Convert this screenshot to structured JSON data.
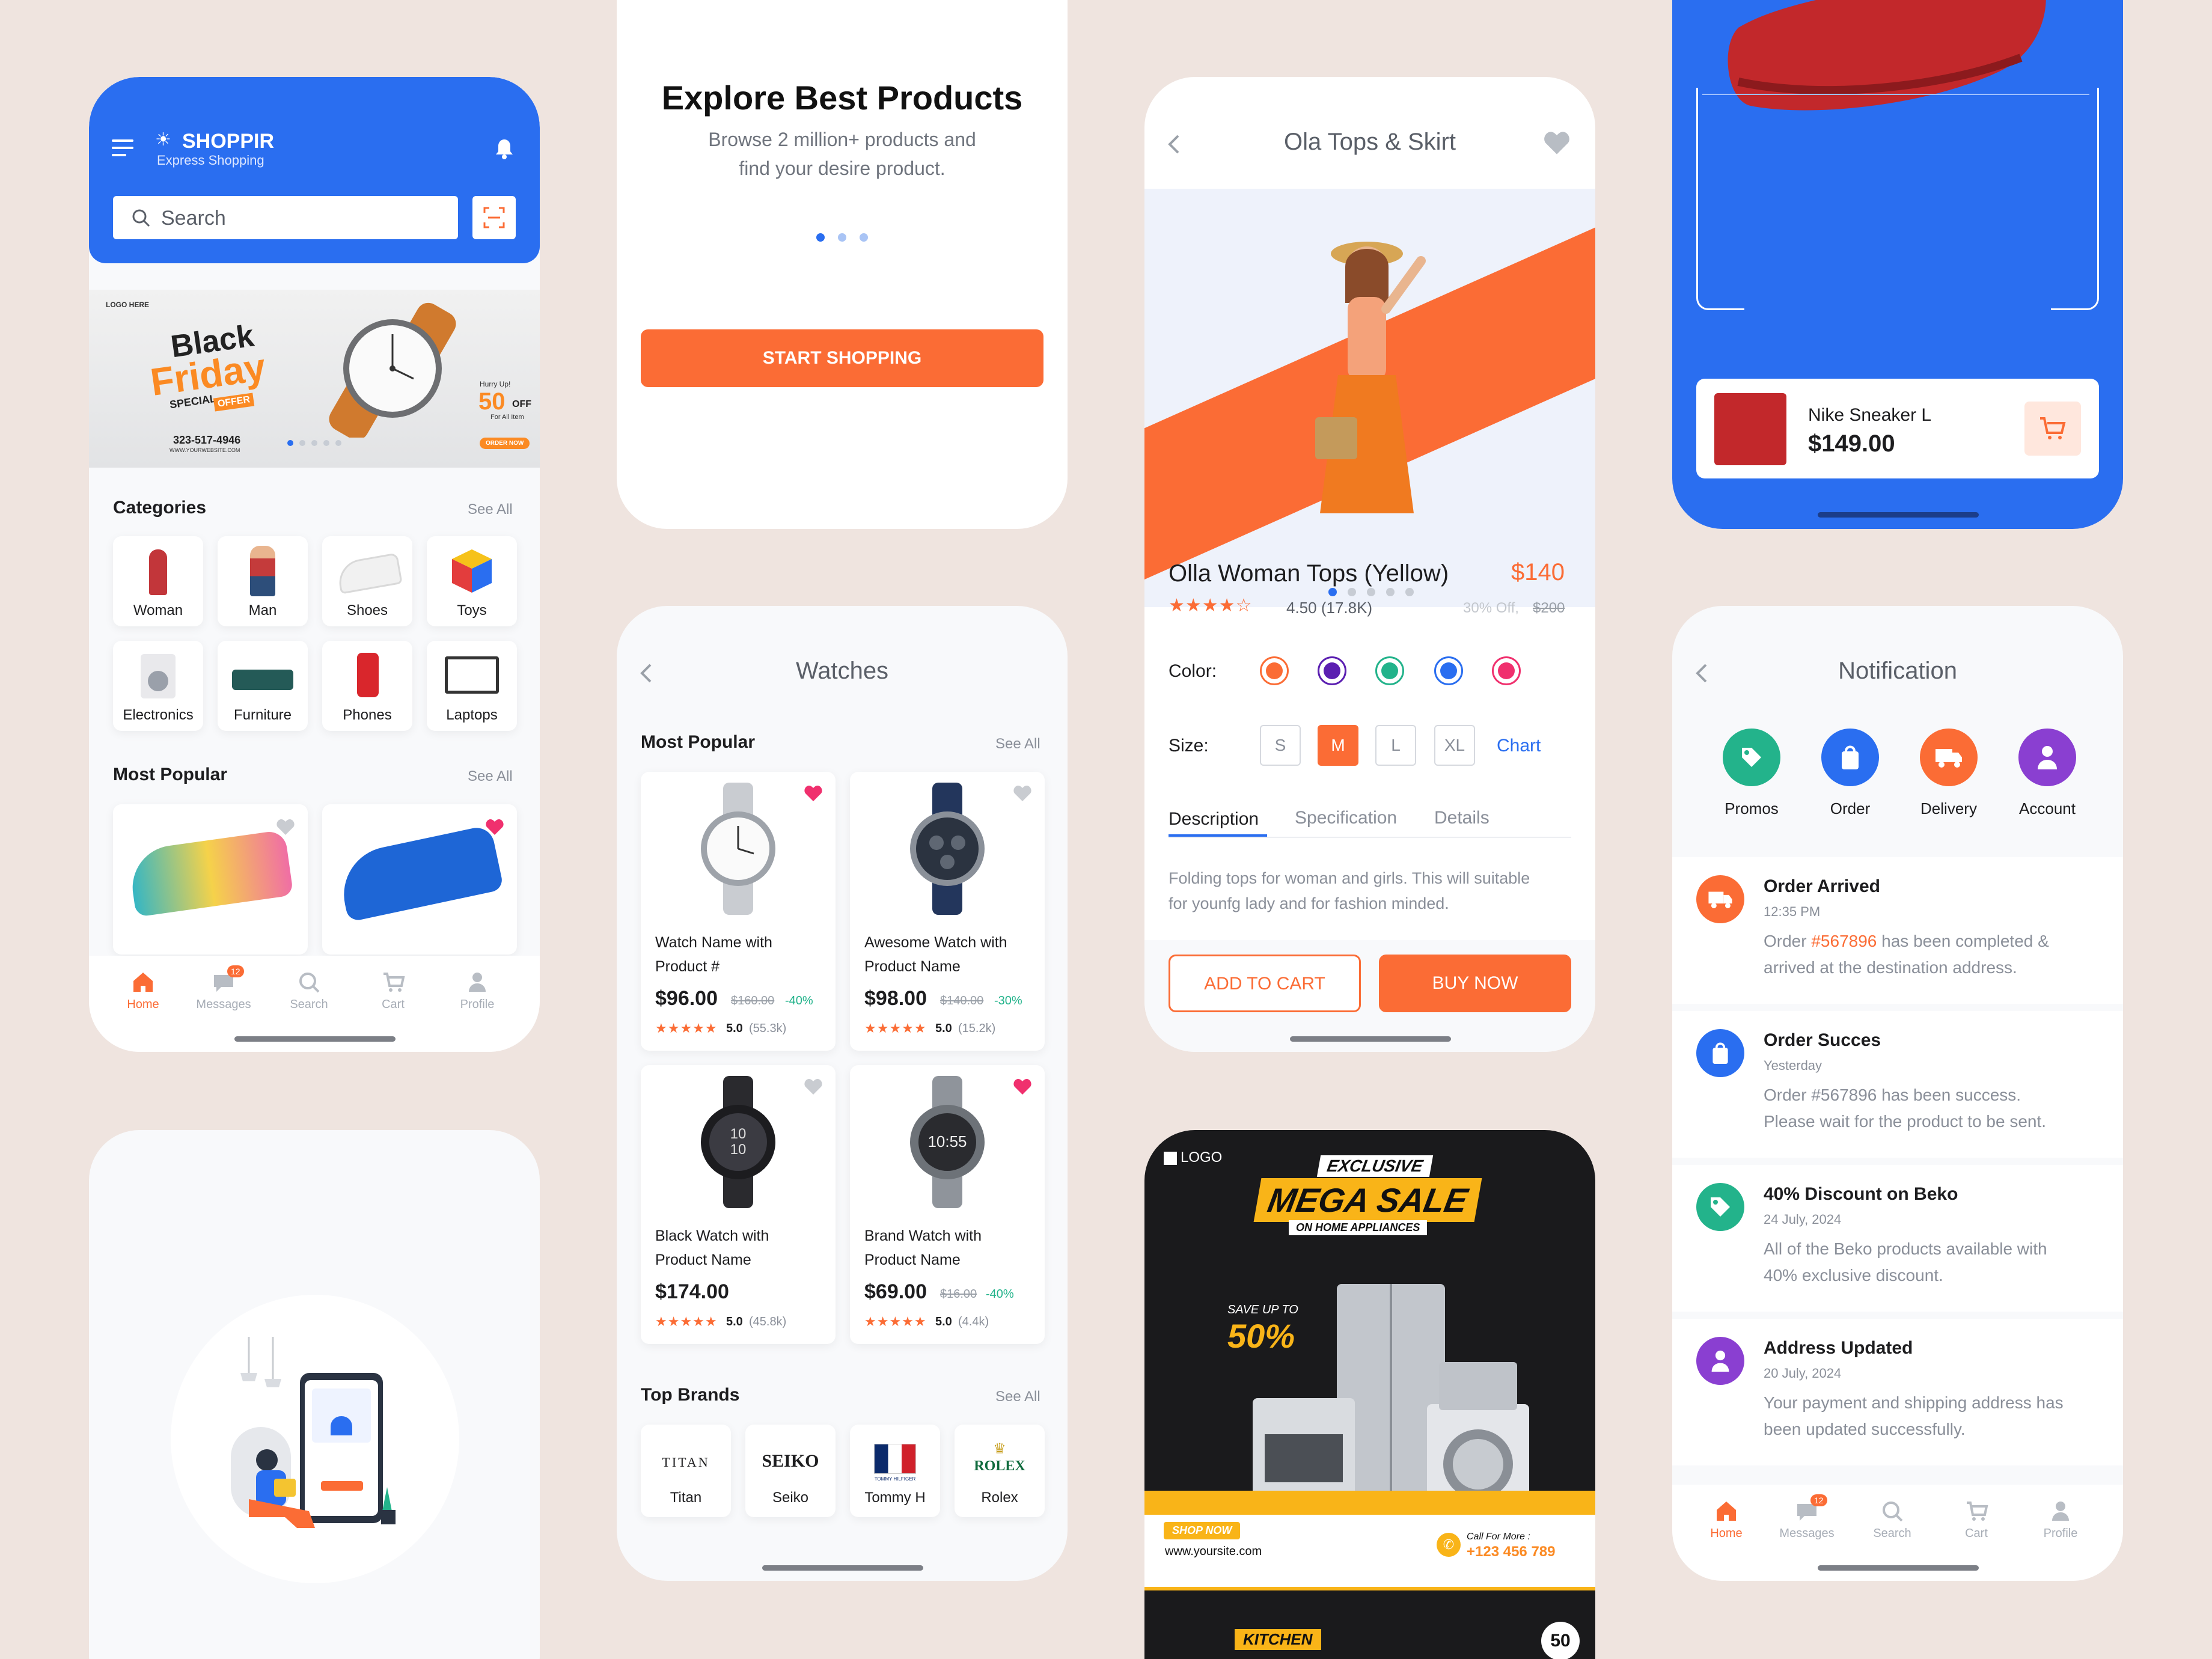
{
  "home": {
    "brand": "SHOPPIR",
    "tagline": "Express Shopping",
    "search_placeholder": "Search",
    "banner": {
      "title1": "Black",
      "title2": "Friday",
      "special": "SPECIAL",
      "offer": "OFFER",
      "hurry": "Hurry Up!",
      "pct": "50",
      "off": "OFF",
      "forall": "For All Item",
      "phone": "323-517-4946",
      "site": "WWW.YOURWEBSITE.COM",
      "order": "ORDER NOW",
      "logo": "LOGO HERE"
    },
    "categories_title": "Categories",
    "categories_see_all": "See All",
    "categories": [
      "Woman",
      "Man",
      "Shoes",
      "Toys",
      "Electronics",
      "Furniture",
      "Phones",
      "Laptops"
    ],
    "popular_title": "Most Popular",
    "popular_see_all": "See All",
    "nav": [
      "Home",
      "Messages",
      "Search",
      "Cart",
      "Profile"
    ],
    "badge": "12"
  },
  "onboarding": {
    "title": "Explore Best Products",
    "subtitle1": "Browse 2 million+ products and",
    "subtitle2": "find your desire product.",
    "cta": "START SHOPPING"
  },
  "watches": {
    "title": "Watches",
    "popular_title": "Most Popular",
    "see_all": "See All",
    "products": [
      {
        "name1": "Watch Name with",
        "name2": "Product #",
        "price": "$96.00",
        "old": "$160.00",
        "disc": "-40%",
        "rating": "5.0",
        "count": "(55.3k)"
      },
      {
        "name1": "Awesome Watch with",
        "name2": "Product Name",
        "price": "$98.00",
        "old": "$140.00",
        "disc": "-30%",
        "rating": "5.0",
        "count": "(15.2k)"
      },
      {
        "name1": "Black Watch with",
        "name2": "Product Name",
        "price": "$174.00",
        "old": "",
        "disc": "",
        "rating": "5.0",
        "count": "(45.8k)"
      },
      {
        "name1": "Brand Watch with",
        "name2": "Product Name",
        "price": "$69.00",
        "old": "$16.00",
        "disc": "-40%",
        "rating": "5.0",
        "count": "(4.4k)"
      }
    ],
    "brands_title": "Top Brands",
    "brands_see_all": "See All",
    "brands": [
      {
        "logo": "TITAN",
        "name": "Titan"
      },
      {
        "logo": "SEIKO",
        "name": "Seiko"
      },
      {
        "logo": "TOMMY HILFIGER",
        "name": "Tommy H"
      },
      {
        "logo": "ROLEX",
        "name": "Rolex"
      }
    ]
  },
  "detail": {
    "header": "Ola Tops & Skirt",
    "name": "Olla Woman Tops (Yellow)",
    "price": "$140",
    "rating": "4.50 (17.8K)",
    "discount": "30% Off,",
    "old_price": "$200",
    "color_label": "Color:",
    "colors": [
      "#fb6c35",
      "#5b1fb1",
      "#23b38b",
      "#2a6ef0",
      "#f0306e"
    ],
    "size_label": "Size:",
    "sizes": [
      "S",
      "M",
      "L",
      "XL"
    ],
    "chart_link": "Chart",
    "tabs": [
      "Description",
      "Specification",
      "Details"
    ],
    "desc1": "Folding tops for woman and girls. This will suitable",
    "desc2": "for younfg lady and for fashion minded.",
    "add_to_cart": "ADD TO CART",
    "buy_now": "BUY NOW"
  },
  "sale": {
    "logo": "LOGO",
    "exclusive": "EXCLUSIVE",
    "mega": "MEGA SALE",
    "home": "ON HOME APPLIANCES",
    "save": "SAVE UP TO",
    "pct": "50%",
    "shop": "SHOP NOW",
    "site": "www.yoursite.com",
    "call": "Call For More :",
    "phone": "+123 456 789",
    "kitchen": "KITCHEN",
    "badge": "50"
  },
  "scan": {
    "product": "Nike Sneaker L",
    "price": "$149.00"
  },
  "notification": {
    "title": "Notification",
    "cats": [
      "Promos",
      "Order",
      "Delivery",
      "Account"
    ],
    "items": [
      {
        "title": "Order Arrived",
        "time": "12:35 PM",
        "pre": "Order ",
        "link": "#567896",
        "post": " has been completed &",
        "line2": "arrived at the destination address."
      },
      {
        "title": "Order Succes",
        "time": "Yesterday",
        "pre": "Order #567896 has been success.",
        "link": "",
        "post": "",
        "line2": "Please wait for the product to be sent."
      },
      {
        "title": "40% Discount on Beko",
        "time": "24 July, 2024",
        "pre": "All of the Beko products available with",
        "link": "",
        "post": "",
        "line2": "40% exclusive discount."
      },
      {
        "title": "Address Updated",
        "time": "20 July, 2024",
        "pre": "Your payment and shipping address has",
        "link": "",
        "post": "",
        "line2": "been updated successfully."
      }
    ],
    "nav": [
      "Home",
      "Messages",
      "Search",
      "Cart",
      "Profile"
    ],
    "badge": "12"
  }
}
